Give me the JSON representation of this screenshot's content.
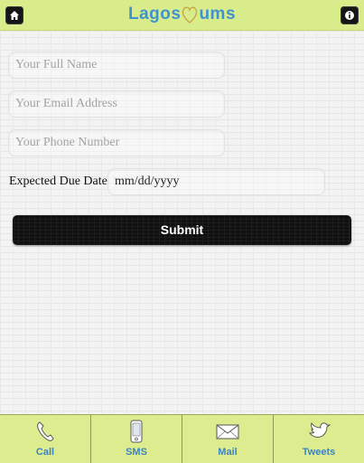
{
  "header": {
    "logo_text_before": "Lagos",
    "logo_text_after": "ums",
    "home_icon": "home-icon",
    "info_icon": "info-icon"
  },
  "form": {
    "full_name_placeholder": "Your Full Name",
    "email_placeholder": "Your Email Address",
    "phone_placeholder": "Your Phone Number",
    "due_date_label": "Expected Due Date",
    "due_date_value": "mm/dd/yyyy",
    "submit_label": "Submit"
  },
  "tabbar": {
    "items": [
      {
        "label": "Call",
        "icon": "phone-icon"
      },
      {
        "label": "SMS",
        "icon": "mobile-icon"
      },
      {
        "label": "Mail",
        "icon": "envelope-icon"
      },
      {
        "label": "Tweets",
        "icon": "bird-icon"
      }
    ]
  },
  "colors": {
    "header_bg": "#d9ec8c",
    "logo_blue": "#3e93cf",
    "tab_label_blue": "#3d83c2",
    "button_black": "#101010"
  }
}
